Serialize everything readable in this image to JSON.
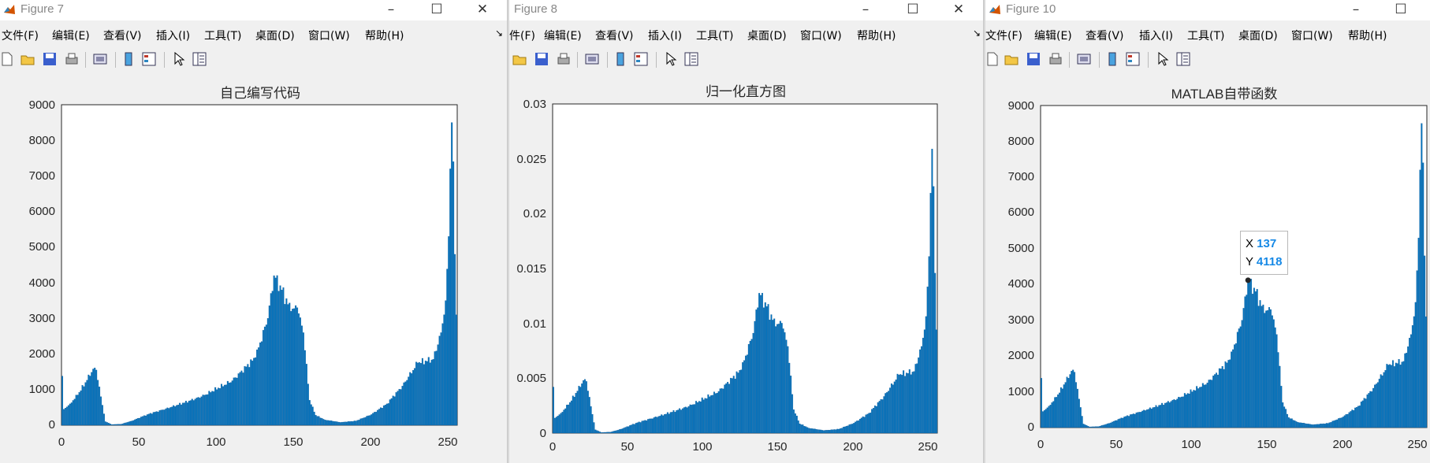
{
  "windows": [
    {
      "title": "Figure 7",
      "menu": [
        "文件(F)",
        "编辑(E)",
        "查看(V)",
        "插入(I)",
        "工具(T)",
        "桌面(D)",
        "窗口(W)",
        "帮助(H)"
      ],
      "axes": {
        "title": "自己编写代码",
        "yticks": [
          "0",
          "1000",
          "2000",
          "3000",
          "4000",
          "5000",
          "6000",
          "7000",
          "8000",
          "9000"
        ],
        "xticks": [
          "0",
          "50",
          "100",
          "150",
          "200",
          "250"
        ]
      }
    },
    {
      "title": "Figure 8",
      "menu": [
        "件(F)",
        "编辑(E)",
        "查看(V)",
        "插入(I)",
        "工具(T)",
        "桌面(D)",
        "窗口(W)",
        "帮助(H)"
      ],
      "axes": {
        "title": "归一化直方图",
        "yticks": [
          "0",
          "0.005",
          "0.01",
          "0.015",
          "0.02",
          "0.025",
          "0.03"
        ],
        "xticks": [
          "0",
          "50",
          "100",
          "150",
          "200",
          "250"
        ]
      }
    },
    {
      "title": "Figure 10",
      "menu": [
        "文件(F)",
        "编辑(E)",
        "查看(V)",
        "插入(I)",
        "工具(T)",
        "桌面(D)",
        "窗口(W)",
        "帮助(H)"
      ],
      "axes": {
        "title": "MATLAB自带函数",
        "yticks": [
          "0",
          "1000",
          "2000",
          "3000",
          "4000",
          "5000",
          "6000",
          "7000",
          "8000",
          "9000"
        ],
        "xticks": [
          "0",
          "50",
          "100",
          "150",
          "200",
          "250"
        ]
      },
      "datatip": {
        "x_label": "X",
        "x_value": "137",
        "y_label": "Y",
        "y_value": "4118"
      }
    }
  ],
  "colors": {
    "bar": "#0072bd",
    "datatip_value": "#1689e6"
  },
  "chart_data": [
    {
      "type": "bar",
      "title": "自己编写代码",
      "xlim": [
        0,
        256
      ],
      "ylim": [
        0,
        9000
      ],
      "anchor_x": [
        0,
        1,
        5,
        10,
        15,
        20,
        22,
        25,
        28,
        32,
        38,
        45,
        55,
        70,
        90,
        110,
        125,
        133,
        137,
        142,
        148,
        152,
        156,
        160,
        164,
        170,
        180,
        190,
        200,
        210,
        220,
        230,
        240,
        245,
        248,
        250,
        251,
        252,
        253,
        254,
        255
      ],
      "anchor_y": [
        1380,
        450,
        600,
        850,
        1200,
        1580,
        1550,
        800,
        100,
        20,
        30,
        120,
        300,
        500,
        800,
        1250,
        1900,
        3000,
        4200,
        3800,
        3200,
        3300,
        2600,
        700,
        280,
        150,
        80,
        120,
        300,
        600,
        1100,
        1750,
        1850,
        2600,
        3500,
        5300,
        7200,
        8500,
        7400,
        4800,
        3100
      ]
    },
    {
      "type": "bar",
      "title": "归一化直方图",
      "xlim": [
        0,
        256
      ],
      "ylim": [
        0,
        0.03
      ],
      "anchor_x": [
        0,
        1,
        5,
        10,
        15,
        20,
        22,
        25,
        28,
        32,
        38,
        45,
        55,
        70,
        90,
        110,
        125,
        133,
        137,
        142,
        148,
        152,
        156,
        160,
        164,
        170,
        180,
        190,
        200,
        210,
        220,
        230,
        240,
        245,
        248,
        250,
        251,
        252,
        253,
        254,
        255
      ],
      "anchor_y": [
        0.0042,
        0.00137,
        0.00182,
        0.00258,
        0.00364,
        0.0048,
        0.00471,
        0.00243,
        0.0003,
        6e-05,
        9e-05,
        0.00036,
        0.00091,
        0.00152,
        0.00243,
        0.0038,
        0.00577,
        0.00911,
        0.01275,
        0.01154,
        0.00972,
        0.01002,
        0.0079,
        0.00213,
        0.00085,
        0.00046,
        0.00024,
        0.00036,
        0.00091,
        0.00182,
        0.00334,
        0.00531,
        0.00562,
        0.0079,
        0.01063,
        0.0161,
        0.02187,
        0.0259,
        0.02248,
        0.01458,
        0.00942
      ]
    },
    {
      "type": "bar",
      "title": "MATLAB自带函数",
      "xlim": [
        0,
        256
      ],
      "ylim": [
        0,
        9000
      ],
      "anchor_x": [
        0,
        1,
        5,
        10,
        15,
        20,
        22,
        25,
        28,
        32,
        38,
        45,
        55,
        70,
        90,
        110,
        125,
        133,
        137,
        142,
        148,
        152,
        156,
        160,
        164,
        170,
        180,
        190,
        200,
        210,
        220,
        230,
        240,
        245,
        248,
        250,
        251,
        252,
        253,
        254,
        255
      ],
      "anchor_y": [
        1380,
        450,
        600,
        850,
        1200,
        1580,
        1550,
        800,
        100,
        20,
        30,
        120,
        300,
        500,
        800,
        1250,
        1900,
        3000,
        4118,
        3800,
        3200,
        3300,
        2600,
        700,
        280,
        150,
        80,
        120,
        300,
        600,
        1100,
        1750,
        1850,
        2600,
        3500,
        5300,
        7200,
        8500,
        7400,
        4800,
        3100
      ]
    }
  ]
}
